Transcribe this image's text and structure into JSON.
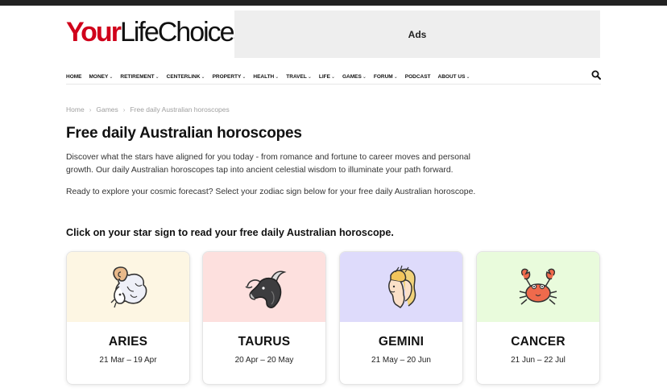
{
  "logo": {
    "part1": "Your",
    "part2": "LifeChoices"
  },
  "ad": {
    "label": "Ads"
  },
  "nav": {
    "items": [
      {
        "label": "HOME",
        "dropdown": false
      },
      {
        "label": "MONEY",
        "dropdown": true
      },
      {
        "label": "RETIREMENT",
        "dropdown": true
      },
      {
        "label": "CENTERLINK",
        "dropdown": true
      },
      {
        "label": "PROPERTY",
        "dropdown": true
      },
      {
        "label": "HEALTH",
        "dropdown": true
      },
      {
        "label": "TRAVEL",
        "dropdown": true
      },
      {
        "label": "LIFE",
        "dropdown": true
      },
      {
        "label": "GAMES",
        "dropdown": true
      },
      {
        "label": "FORUM",
        "dropdown": true
      },
      {
        "label": "PODCAST",
        "dropdown": false
      },
      {
        "label": "ABOUT US",
        "dropdown": true
      }
    ],
    "search_icon": "search-icon"
  },
  "breadcrumb": [
    "Home",
    "Games",
    "Free daily Australian horoscopes"
  ],
  "page": {
    "title": "Free daily Australian horoscopes",
    "intro": "Discover what the stars have aligned for you today - from romance and fortune to career moves and personal growth. Our daily Australian horoscopes tap into ancient celestial wisdom to illuminate your path forward.",
    "cta": "Ready to explore your cosmic forecast? Select your zodiac sign below for your free daily Australian horoscope.",
    "section_heading": "Click on your star sign to read your free daily Australian horoscope."
  },
  "signs": [
    {
      "name": "ARIES",
      "dates": "21 Mar – 19 Apr",
      "bg": "#fdf6e3",
      "icon": "ram-icon"
    },
    {
      "name": "TAURUS",
      "dates": "20 Apr – 20 May",
      "bg": "#fde0de",
      "icon": "bull-icon"
    },
    {
      "name": "GEMINI",
      "dates": "21 May – 20 Jun",
      "bg": "#dedbfb",
      "icon": "twins-icon"
    },
    {
      "name": "CANCER",
      "dates": "21 Jun – 22 Jul",
      "bg": "#e9fbdc",
      "icon": "crab-icon"
    }
  ],
  "colors": {
    "brand_red": "#d0021b",
    "top_bar": "#222222",
    "ad_bg": "#eeeeee"
  }
}
